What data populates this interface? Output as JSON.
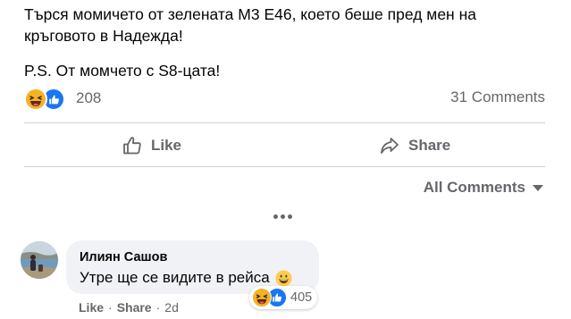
{
  "post": {
    "line1": "Търся момичето от зелената М3 Е46, което беше пред мен на",
    "line2": "кръговото в Надежда!",
    "ps": "P.S. От момчето с S8-цата!"
  },
  "reactions": {
    "types": [
      "haha-icon",
      "like-icon"
    ],
    "count": "208",
    "comments_count": "31 Comments"
  },
  "actions": {
    "like_label": "Like",
    "share_label": "Share"
  },
  "comments_filter": {
    "label": "All Comments"
  },
  "comment": {
    "author": "Илиян Сашов",
    "text": "Утре ще се видите в рейса",
    "reaction_types": [
      "haha-icon",
      "like-icon"
    ],
    "reaction_count": "405",
    "like_label": "Like",
    "share_label": "Share",
    "separator": "·",
    "time": "2d"
  },
  "colors": {
    "primary_text": "#050505",
    "secondary_text": "#65676b",
    "like_blue": "#1877f2",
    "haha_yellow": "#f7b125",
    "bubble_bg": "#f0f2f5",
    "divider": "#ced0d4"
  }
}
